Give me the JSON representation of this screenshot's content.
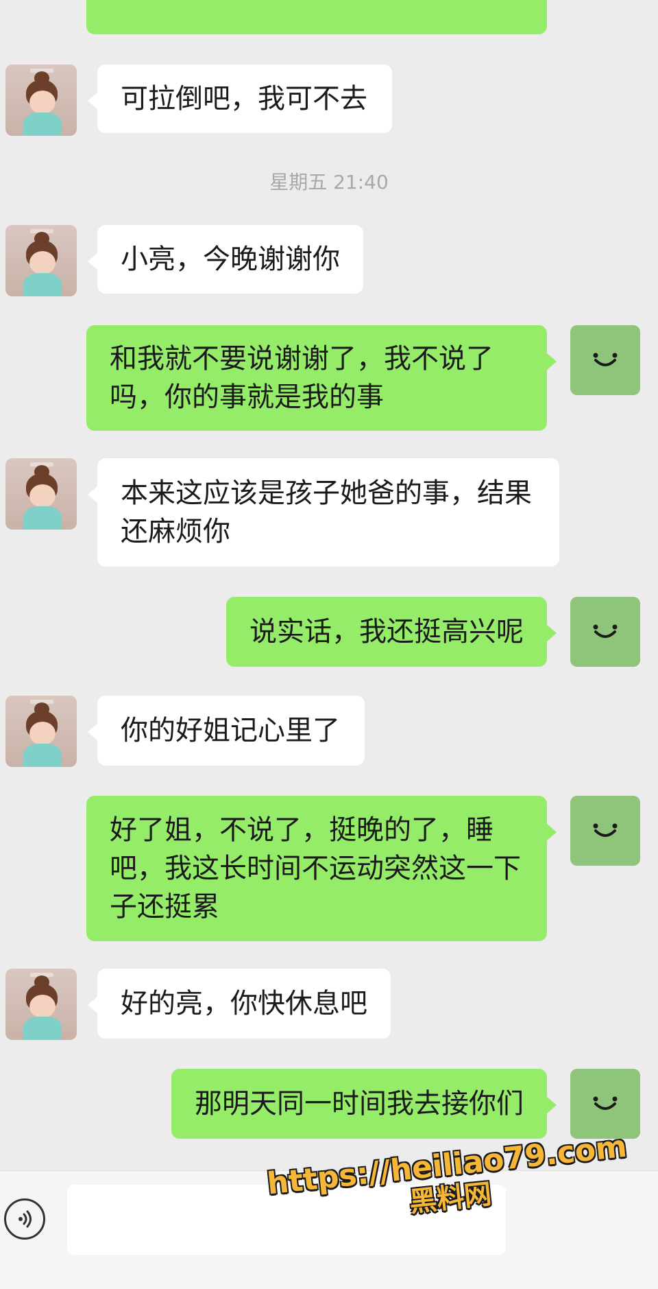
{
  "chat": {
    "timestamp": "星期五 21:40",
    "messages": [
      {
        "side": "in",
        "text": "可拉倒吧，我可不去"
      },
      {
        "side": "in",
        "text": "小亮，今晚谢谢你"
      },
      {
        "side": "out",
        "text": "和我就不要说谢谢了，我不说了\n吗，你的事就是我的事"
      },
      {
        "side": "in",
        "text": "本来这应该是孩子她爸的事，结果\n还麻烦你"
      },
      {
        "side": "out",
        "text": "说实话，我还挺高兴呢"
      },
      {
        "side": "in",
        "text": "你的好姐记心里了"
      },
      {
        "side": "out",
        "text": "好了姐，不说了，挺晚的了，睡\n吧，我这长时间不运动突然这一下\n子还挺累"
      },
      {
        "side": "in",
        "text": "好的亮，你快休息吧"
      },
      {
        "side": "out",
        "text": "那明天同一时间我去接你们"
      }
    ]
  },
  "avatars": {
    "contact": "girl-avatar-icon",
    "me": "smile-icon"
  },
  "input_bar": {
    "placeholder": ""
  },
  "watermark": {
    "url": "https://heiliao79.com",
    "cn": "黑料网"
  },
  "colors": {
    "background": "#ececec",
    "outgoing_bubble": "#95ec69",
    "incoming_bubble": "#ffffff",
    "my_avatar": "#8fc57a"
  }
}
